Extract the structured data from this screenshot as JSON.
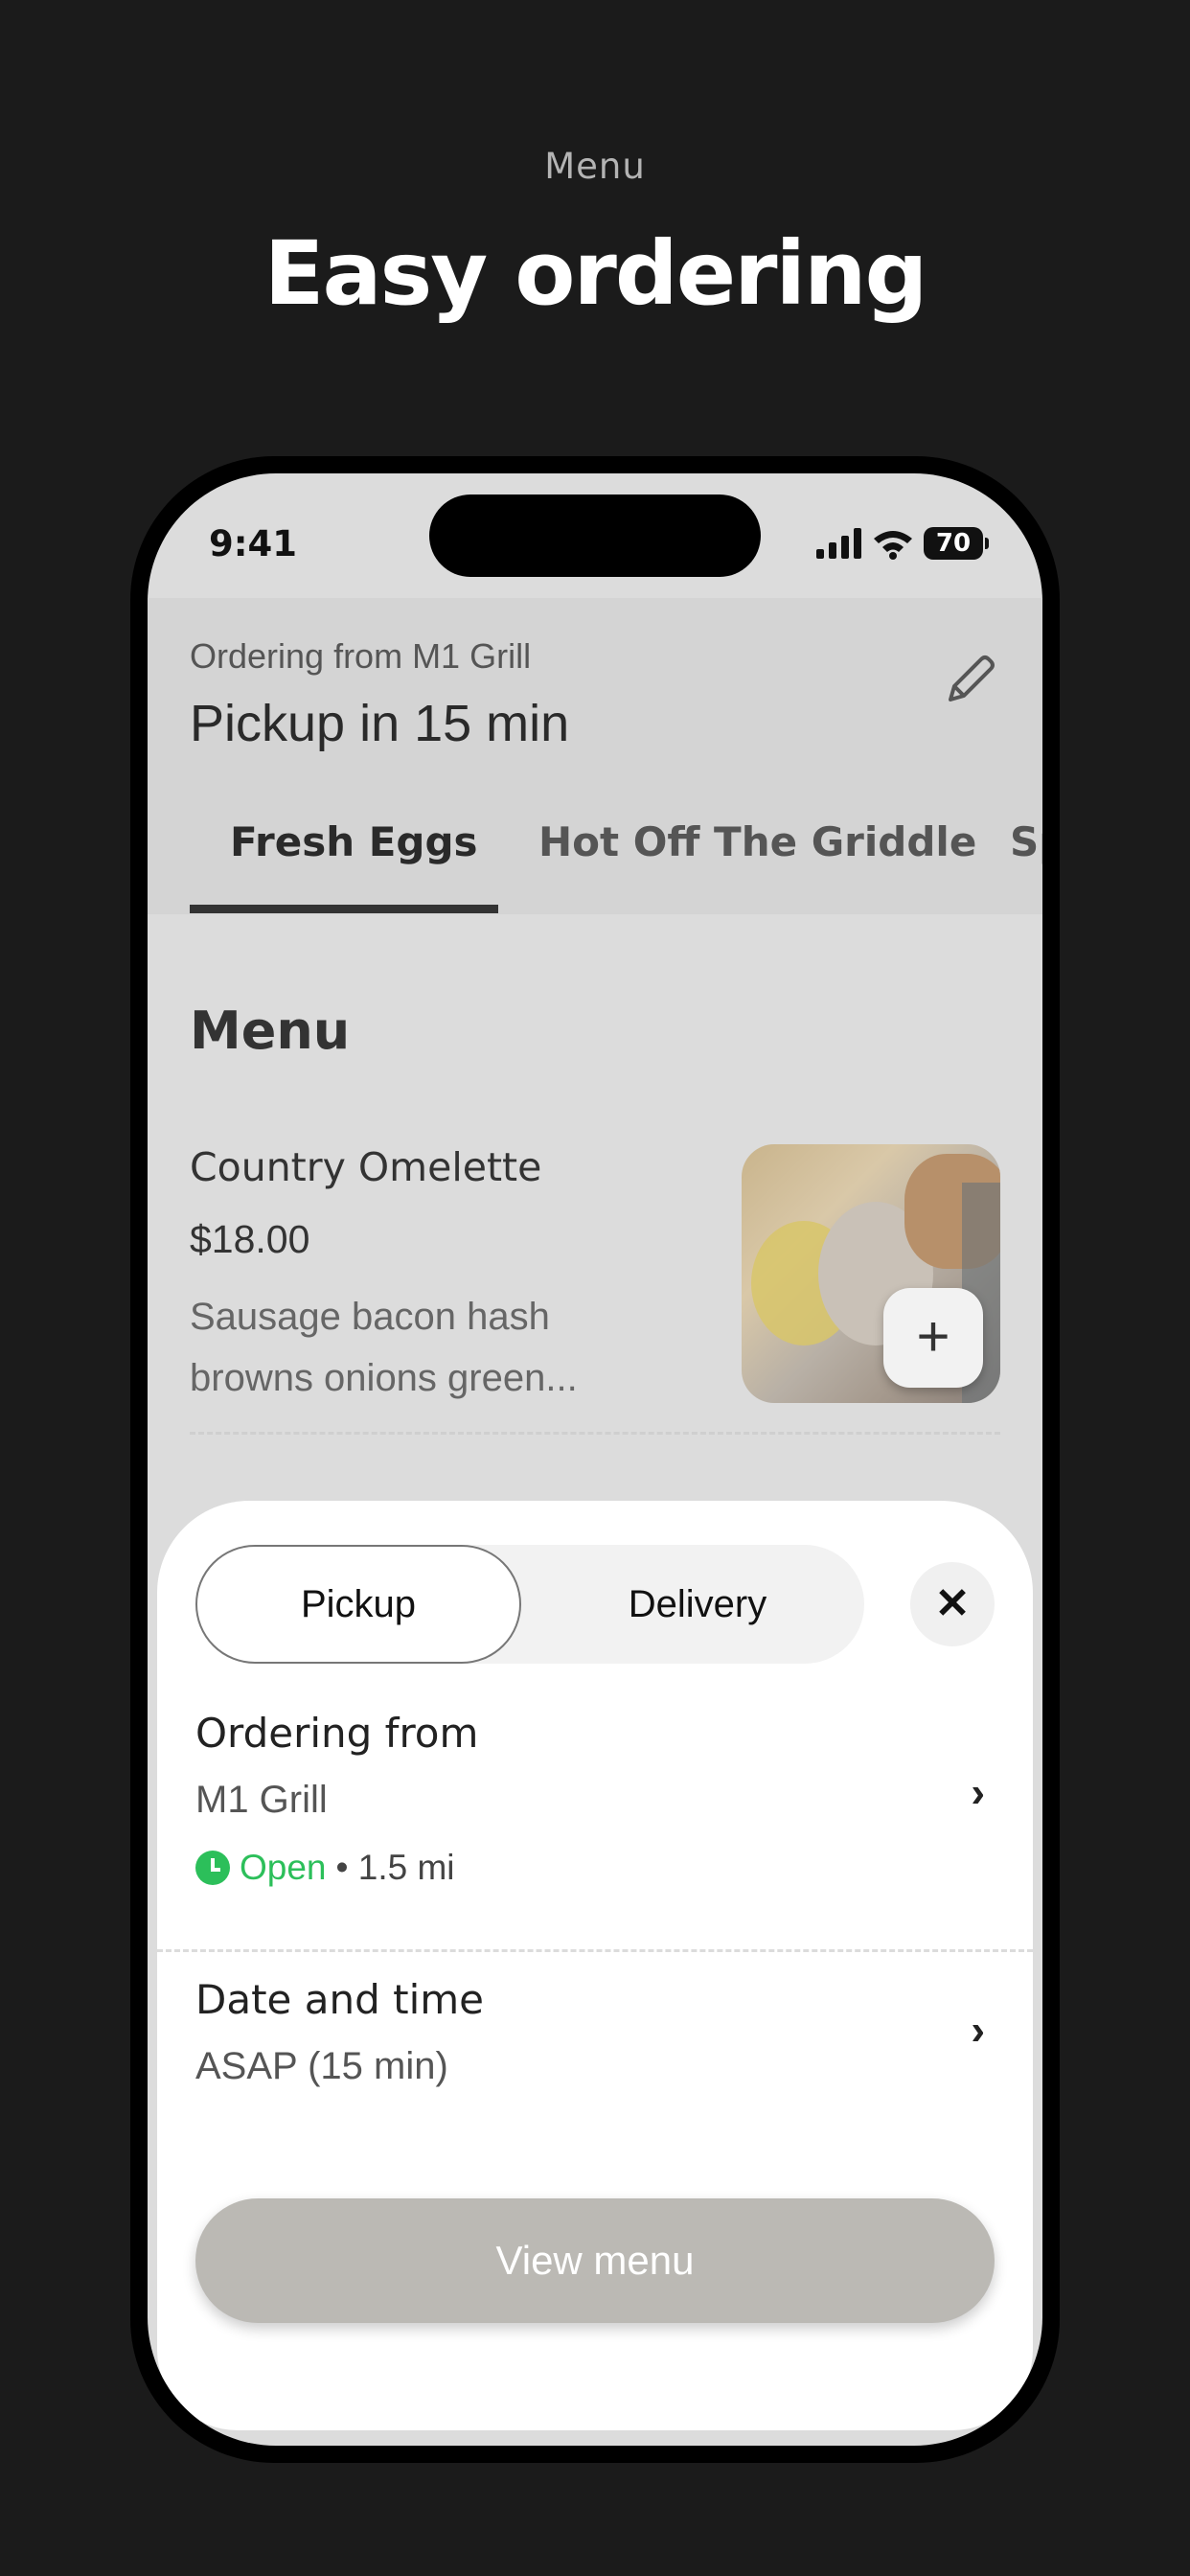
{
  "promo": {
    "eyebrow": "Menu",
    "title": "Easy ordering"
  },
  "status_bar": {
    "time": "9:41",
    "battery": "70"
  },
  "header": {
    "ordering_from": "Ordering from M1 Grill",
    "pickup_time": "Pickup in 15 min",
    "edit_icon": "pencil-icon"
  },
  "tabs": [
    "Fresh Eggs",
    "Hot Off The Griddle",
    "Sp"
  ],
  "menu": {
    "title": "Menu",
    "item": {
      "name": "Country Omelette",
      "price": "$18.00",
      "description": "Sausage bacon hash browns onions green...",
      "add_label": "+"
    }
  },
  "sheet": {
    "mode_options": [
      "Pickup",
      "Delivery"
    ],
    "selected_mode": "Pickup",
    "close_label": "✕",
    "ordering_label": "Ordering from",
    "restaurant": "M1 Grill",
    "open_status": "Open",
    "distance": "• 1.5 mi",
    "date_label": "Date and time",
    "date_value": "ASAP (15 min)",
    "chevron": "›",
    "button": "View menu"
  },
  "colors": {
    "accent_open": "#2cbf5a",
    "background": "#1b1b1b"
  }
}
